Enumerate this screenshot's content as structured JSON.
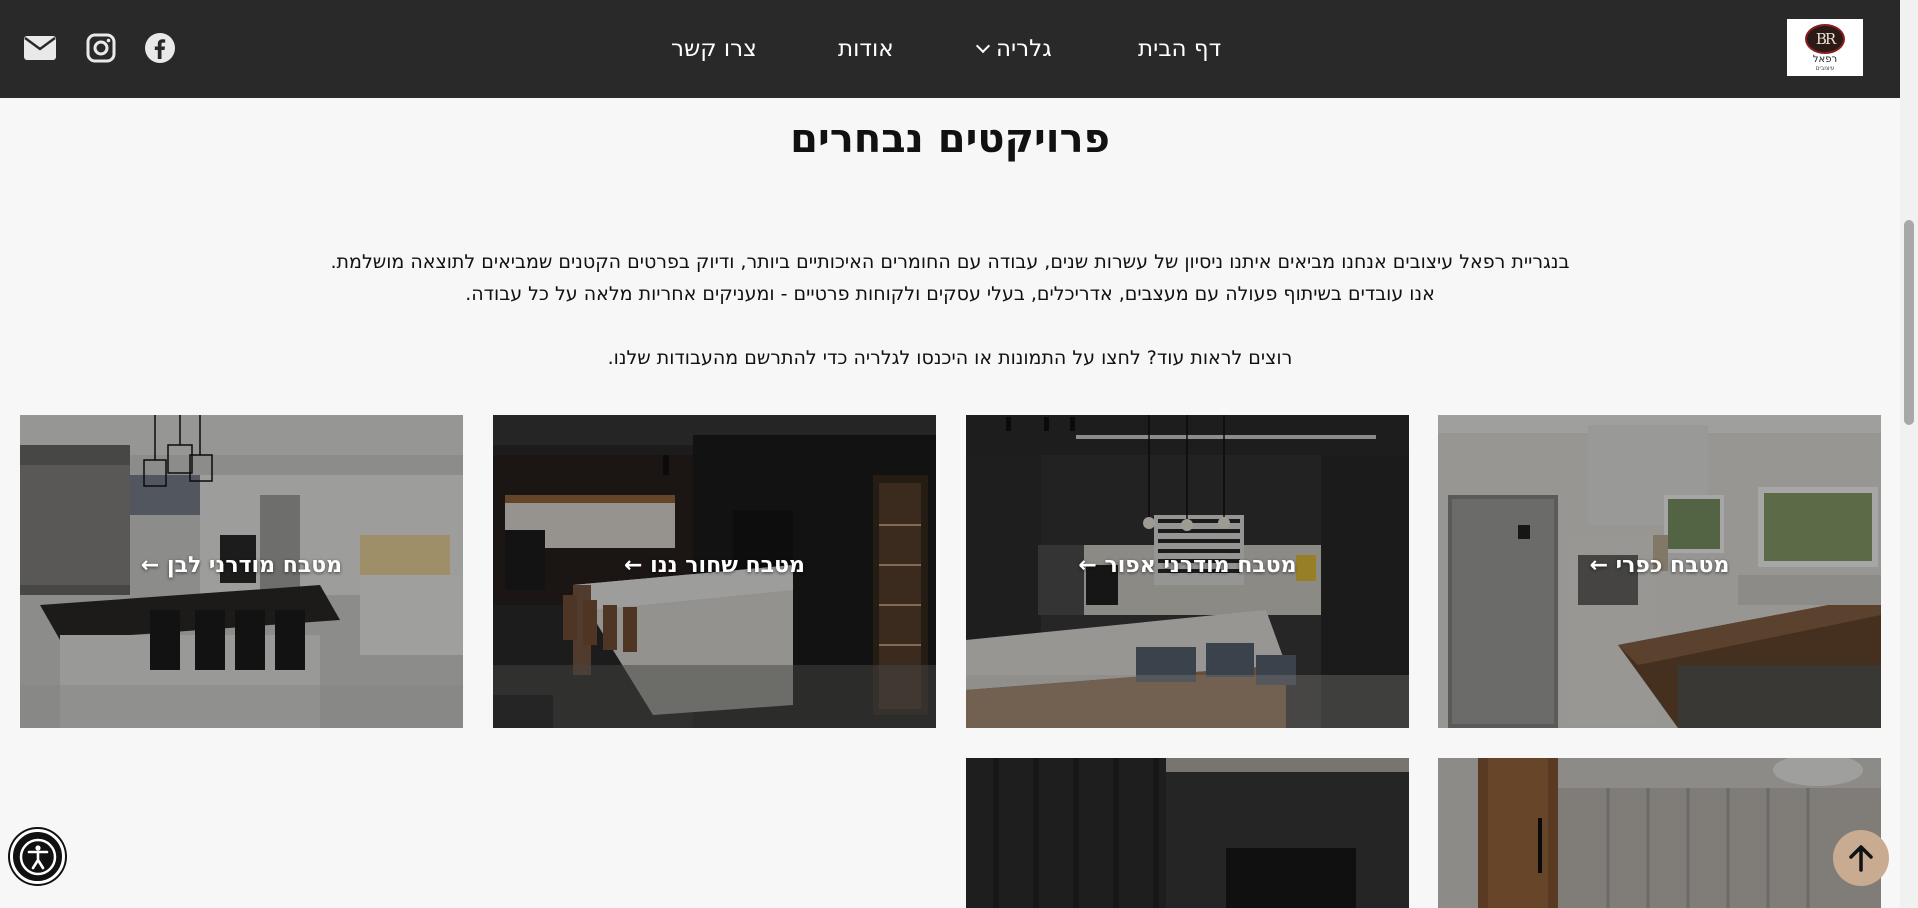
{
  "logo": {
    "mark": "BR",
    "name": "רפאל",
    "sub": "עיצובים"
  },
  "nav": {
    "home": "דף הבית",
    "gallery": "גלריה",
    "about": "אודות",
    "contact": "צרו קשר"
  },
  "social": [
    "facebook-icon",
    "instagram-icon",
    "email-icon"
  ],
  "header_color": "#292929",
  "accent_color": "#c8ab90",
  "page_title": "פרויקטים נבחרים",
  "intro": {
    "line1": "בנגריית רפאל עיצובים אנחנו מביאים איתנו ניסיון של עשרות שנים, עבודה עם החומרים האיכותיים ביותר, ודיוק בפרטים הקטנים שמביאים לתוצאה מושלמת.",
    "line2": "אנו עובדים בשיתוף פעולה עם מעצבים, אדריכלים, בעלי עסקים ולקוחות פרטיים - ומעניקים אחריות מלאה על כל עבודה.",
    "line3": "רוצים לראות עוד? לחצו על התמונות או היכנסו לגלריה כדי להתרשם מהעבודות שלנו."
  },
  "projects": [
    {
      "label": "מטבח כפרי ←"
    },
    {
      "label": "מטבח מודרני אפור ←"
    },
    {
      "label": "מטבח שחור ננו ←"
    },
    {
      "label": "מטבח מודרני לבן ←"
    }
  ]
}
